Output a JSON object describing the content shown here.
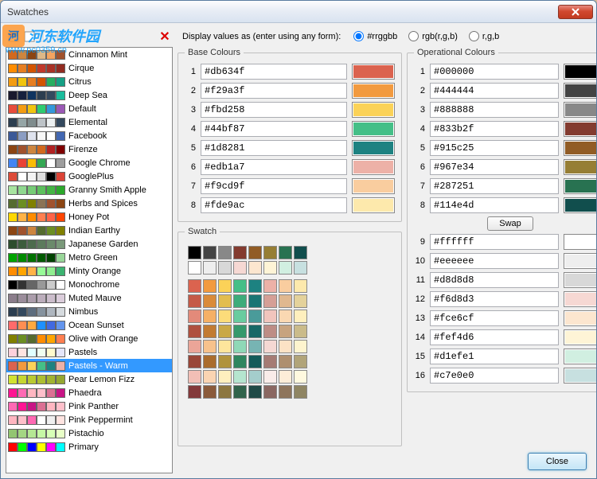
{
  "window": {
    "title": "Swatches"
  },
  "watermark": {
    "text": "河东软件园",
    "url": "www.pc0359.cn"
  },
  "display": {
    "label": "Display values as (enter using any form):",
    "options": [
      "#rrggbb",
      "rgb(r,g,b)",
      "r,g,b"
    ],
    "selected": 0
  },
  "fieldsets": {
    "base": "Base Colours",
    "operational": "Operational Colours",
    "swatch": "Swatch"
  },
  "buttons": {
    "swap": "Swap",
    "close": "Close"
  },
  "swatches": [
    {
      "name": "Cinnamon Mint",
      "colors": [
        "#d2691e",
        "#cd853f",
        "#8b4513",
        "#deb887",
        "#f4a460",
        "#a0522d"
      ]
    },
    {
      "name": "Cirque",
      "colors": [
        "#ff8c00",
        "#e67e22",
        "#d35400",
        "#c0392b",
        "#a93226",
        "#922b21"
      ]
    },
    {
      "name": "Citrus",
      "colors": [
        "#f39c12",
        "#f1c40f",
        "#e67e22",
        "#d35400",
        "#27ae60",
        "#16a085"
      ]
    },
    {
      "name": "Deep Sea",
      "colors": [
        "#1a1a2e",
        "#16213e",
        "#0f3460",
        "#2c3e50",
        "#34495e",
        "#1abc9c"
      ]
    },
    {
      "name": "Default",
      "colors": [
        "#e74c3c",
        "#f39c12",
        "#f1c40f",
        "#2ecc71",
        "#3498db",
        "#9b59b6"
      ]
    },
    {
      "name": "Elemental",
      "colors": [
        "#2c3e50",
        "#95a5a6",
        "#7f8c8d",
        "#bdc3c7",
        "#ecf0f1",
        "#34495e"
      ]
    },
    {
      "name": "Facebook",
      "colors": [
        "#3b5998",
        "#8b9dc3",
        "#dfe3ee",
        "#f7f7f7",
        "#ffffff",
        "#4267b2"
      ]
    },
    {
      "name": "Firenze",
      "colors": [
        "#8b4513",
        "#a0522d",
        "#cd853f",
        "#d2691e",
        "#b22222",
        "#800000"
      ]
    },
    {
      "name": "Google Chrome",
      "colors": [
        "#4285f4",
        "#ea4335",
        "#fbbc05",
        "#34a853",
        "#ffffff",
        "#9e9e9e"
      ]
    },
    {
      "name": "GooglePlus",
      "colors": [
        "#dd4b39",
        "#ffffff",
        "#f4f4f4",
        "#e0e0e0",
        "#000000",
        "#db4437"
      ]
    },
    {
      "name": "Granny Smith Apple",
      "colors": [
        "#a8e4a0",
        "#8fd88f",
        "#76cc76",
        "#5dc05d",
        "#44b444",
        "#2ba82b"
      ]
    },
    {
      "name": "Herbs and Spices",
      "colors": [
        "#556b2f",
        "#6b8e23",
        "#808000",
        "#8b7355",
        "#a0522d",
        "#8b4513"
      ]
    },
    {
      "name": "Honey Pot",
      "colors": [
        "#ffd700",
        "#ffb347",
        "#ff8c00",
        "#ff7f50",
        "#ff6347",
        "#ff4500"
      ]
    },
    {
      "name": "Indian Earthy",
      "colors": [
        "#8b4513",
        "#a0522d",
        "#cd853f",
        "#556b2f",
        "#6b8e23",
        "#808000"
      ]
    },
    {
      "name": "Japanese Garden",
      "colors": [
        "#2e4d2e",
        "#3d5c3d",
        "#4d6b4d",
        "#5c7a5c",
        "#6b8a6b",
        "#7a997a"
      ]
    },
    {
      "name": "Metro Green",
      "colors": [
        "#00a300",
        "#008a00",
        "#007200",
        "#005a00",
        "#004200",
        "#99d699"
      ]
    },
    {
      "name": "Minty Orange",
      "colors": [
        "#ff8c00",
        "#ffa500",
        "#ffb347",
        "#98fb98",
        "#90ee90",
        "#3cb371"
      ]
    },
    {
      "name": "Monochrome",
      "colors": [
        "#000000",
        "#333333",
        "#666666",
        "#999999",
        "#cccccc",
        "#ffffff"
      ]
    },
    {
      "name": "Muted Mauve",
      "colors": [
        "#8b7d8b",
        "#9b8d9b",
        "#ab9dab",
        "#bbadbb",
        "#cbbdcb",
        "#dbcddb"
      ]
    },
    {
      "name": "Nimbus",
      "colors": [
        "#2c3e50",
        "#34495e",
        "#5d6d7e",
        "#85929e",
        "#aeb6bf",
        "#d6dbdf"
      ]
    },
    {
      "name": "Ocean Sunset",
      "colors": [
        "#ff6b6b",
        "#ff8e53",
        "#ffa940",
        "#1e90ff",
        "#4169e1",
        "#6495ed"
      ]
    },
    {
      "name": "Olive with Orange",
      "colors": [
        "#808000",
        "#6b8e23",
        "#556b2f",
        "#ff8c00",
        "#ffa500",
        "#ff7f50"
      ]
    },
    {
      "name": "Pastels",
      "colors": [
        "#ffd1dc",
        "#ffe4e1",
        "#e0ffff",
        "#f0fff0",
        "#fffacd",
        "#e6e6fa"
      ]
    },
    {
      "name": "Pastels - Warm",
      "colors": [
        "#db634f",
        "#f29a3f",
        "#fbd258",
        "#44bf87",
        "#1d8281",
        "#edb1a7"
      ],
      "selected": true
    },
    {
      "name": "Pear Lemon Fizz",
      "colors": [
        "#d1e231",
        "#c5d631",
        "#b9ca31",
        "#adbf31",
        "#a1b331",
        "#95a731"
      ]
    },
    {
      "name": "Phaedra",
      "colors": [
        "#ff1493",
        "#ff69b4",
        "#ffb6c1",
        "#ffc0cb",
        "#db7093",
        "#c71585"
      ]
    },
    {
      "name": "Pink Panther",
      "colors": [
        "#ff69b4",
        "#ff1493",
        "#c71585",
        "#db7093",
        "#ffb6c1",
        "#ffc0cb"
      ]
    },
    {
      "name": "Pink Peppermint",
      "colors": [
        "#ffb6c1",
        "#ffc0cb",
        "#ff69b4",
        "#ffffff",
        "#f0f0f0",
        "#ffe4e1"
      ]
    },
    {
      "name": "Pistachio",
      "colors": [
        "#93c572",
        "#a4d683",
        "#b5e794",
        "#c6f8a5",
        "#d7ffb6",
        "#e8ffc7"
      ]
    },
    {
      "name": "Primary",
      "colors": [
        "#ff0000",
        "#00ff00",
        "#0000ff",
        "#ffff00",
        "#ff00ff",
        "#00ffff"
      ]
    }
  ],
  "base_colors": [
    {
      "n": "1",
      "v": "#db634f"
    },
    {
      "n": "2",
      "v": "#f29a3f"
    },
    {
      "n": "3",
      "v": "#fbd258"
    },
    {
      "n": "4",
      "v": "#44bf87"
    },
    {
      "n": "5",
      "v": "#1d8281"
    },
    {
      "n": "6",
      "v": "#edb1a7"
    },
    {
      "n": "7",
      "v": "#f9cd9f"
    },
    {
      "n": "8",
      "v": "#fde9ac"
    }
  ],
  "operational_colors": [
    {
      "n": "1",
      "v": "#000000"
    },
    {
      "n": "2",
      "v": "#444444"
    },
    {
      "n": "3",
      "v": "#888888"
    },
    {
      "n": "4",
      "v": "#833b2f"
    },
    {
      "n": "5",
      "v": "#915c25"
    },
    {
      "n": "6",
      "v": "#967e34"
    },
    {
      "n": "7",
      "v": "#287251"
    },
    {
      "n": "8",
      "v": "#114e4d"
    },
    {
      "n": "9",
      "v": "#ffffff"
    },
    {
      "n": "10",
      "v": "#eeeeee"
    },
    {
      "n": "11",
      "v": "#d8d8d8"
    },
    {
      "n": "12",
      "v": "#f6d8d3"
    },
    {
      "n": "13",
      "v": "#fce6cf"
    },
    {
      "n": "14",
      "v": "#fef4d6"
    },
    {
      "n": "15",
      "v": "#d1efe1"
    },
    {
      "n": "16",
      "v": "#c7e0e0"
    }
  ],
  "swatch_preview_top": [
    "#000000",
    "#444444",
    "#888888",
    "#833b2f",
    "#915c25",
    "#967e34",
    "#287251",
    "#114e4d",
    "#ffffff",
    "#eeeeee",
    "#d8d8d8",
    "#f6d8d3",
    "#fce6cf",
    "#fef4d6",
    "#d1efe1",
    "#c7e0e0"
  ],
  "swatch_preview_main": [
    "#db634f",
    "#f29a3f",
    "#fbd258",
    "#44bf87",
    "#1d8281",
    "#edb1a7",
    "#f9cd9f",
    "#fde9ac",
    "#c55a47",
    "#da8b39",
    "#e2bd4f",
    "#3dac7a",
    "#1a7574",
    "#d59f96",
    "#e0b88f",
    "#e4d29b",
    "#e38a7a",
    "#f5b066",
    "#fcdc7a",
    "#69cc9f",
    "#4a9b9a",
    "#f1c5bd",
    "#fad8b2",
    "#feefbd",
    "#af503f",
    "#c27b32",
    "#c9a846",
    "#36996c",
    "#176867",
    "#bd8d85",
    "#c7a37f",
    "#cabb8a",
    "#eba598",
    "#f7c28c",
    "#fde59c",
    "#8fd8b7",
    "#77b4b3",
    "#f5d8d3",
    "#fce2c5",
    "#fef4ce",
    "#994637",
    "#aa6c2c",
    "#b0933d",
    "#2f865f",
    "#145b5a",
    "#a57b74",
    "#ae8f6f",
    "#b1a479",
    "#f2bfb6",
    "#fad4b2",
    "#feefbe",
    "#b5e5cf",
    "#a4cdcc",
    "#f9ece9",
    "#fdedd8",
    "#fff9df",
    "#83393a",
    "#8a5a3a",
    "#8c7640",
    "#31634b",
    "#1f4a47",
    "#8a6761",
    "#8e755c",
    "#8f8563"
  ]
}
